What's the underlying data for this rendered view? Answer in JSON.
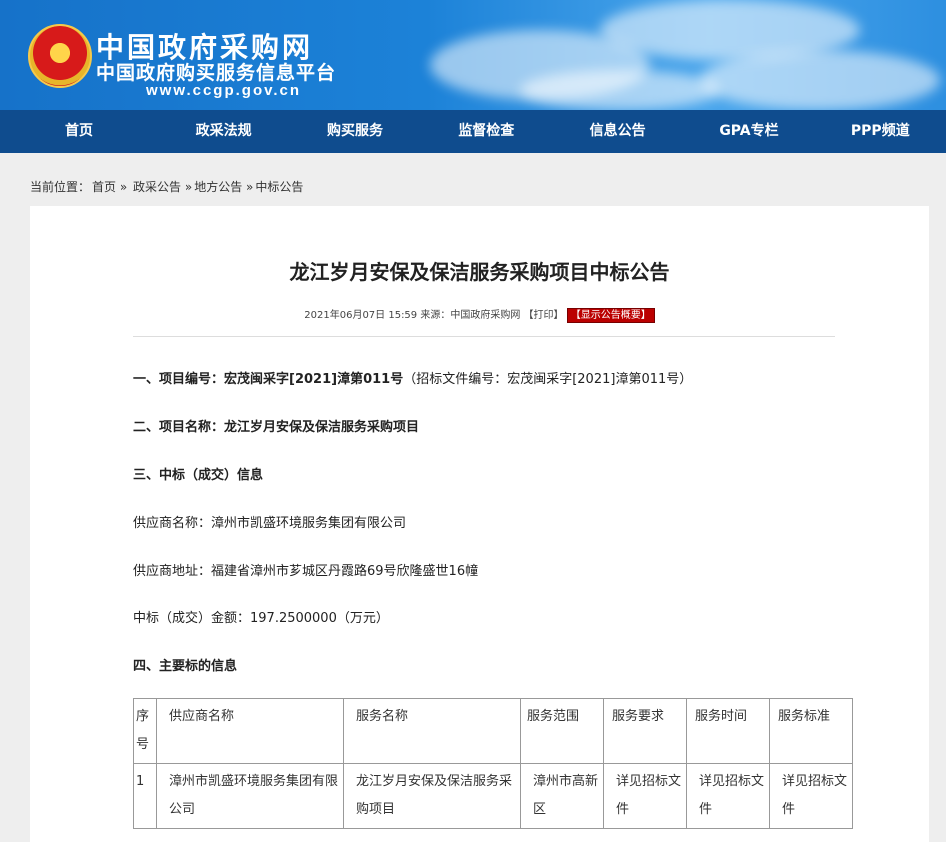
{
  "header": {
    "title_line1": "中国政府采购网",
    "title_line2": "中国政府购买服务信息平台",
    "url": "www.ccgp.gov.cn"
  },
  "nav": {
    "items": [
      "首页",
      "政采法规",
      "购买服务",
      "监督检查",
      "信息公告",
      "GPA专栏",
      "PPP频道"
    ]
  },
  "breadcrumb": {
    "prefix": "当前位置：",
    "items": [
      "首页 »",
      "政采公告 »",
      "地方公告 »",
      "中标公告"
    ]
  },
  "article": {
    "title": "龙江岁月安保及保洁服务采购项目中标公告",
    "meta_date": "2021年06月07日 15:59",
    "meta_source": "来源：中国政府采购网",
    "meta_print": "【打印】",
    "meta_summary": "【显示公告概要】",
    "s1_label": "一、项目编号：",
    "s1_value": "宏茂闽采字[2021]漳第011号",
    "s1_extra": "（招标文件编号：宏茂闽采字[2021]漳第011号）",
    "s2_label": "二、项目名称：",
    "s2_value": "龙江岁月安保及保洁服务采购项目",
    "s3_label": "三、中标（成交）信息",
    "supplier_name": "供应商名称：漳州市凯盛环境服务集团有限公司",
    "supplier_addr": "供应商地址：福建省漳州市芗城区丹霞路69号欣隆盛世16幢",
    "amount": "中标（成交）金额：197.2500000（万元）",
    "s4_label": "四、主要标的信息"
  },
  "table": {
    "headers": [
      "序号",
      "供应商名称",
      "服务名称",
      "服务范围",
      "服务要求",
      "服务时间",
      "服务标准"
    ],
    "row": [
      "1",
      "漳州市凯盛环境服务集团有限公司",
      "龙江岁月安保及保洁服务采购项目",
      "漳州市高新区",
      "详见招标文件",
      "详见招标文件",
      "详见招标文件"
    ]
  }
}
